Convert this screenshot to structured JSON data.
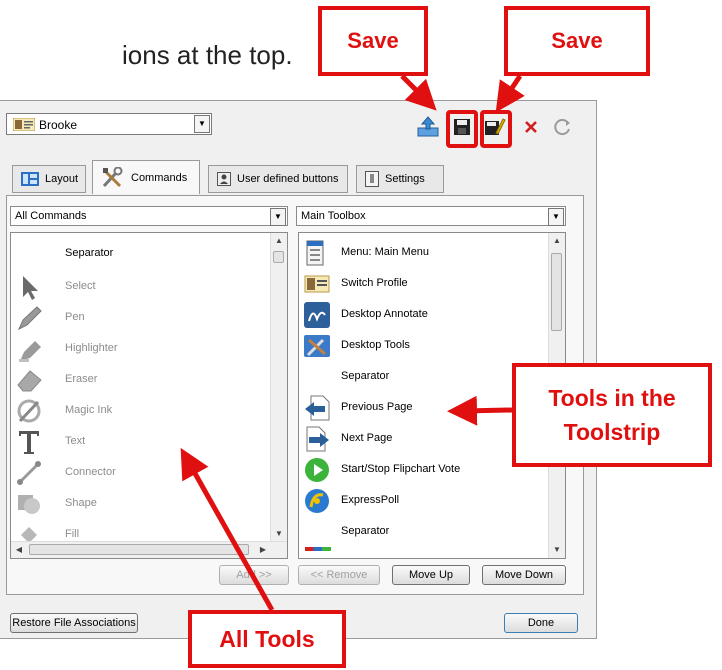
{
  "caption": "ions at the top.",
  "profile": {
    "name": "Brooke"
  },
  "tabs": [
    {
      "label": "Layout"
    },
    {
      "label": "Commands"
    },
    {
      "label": "User defined buttons"
    },
    {
      "label": "Settings"
    }
  ],
  "left_combo": "All Commands",
  "right_combo": "Main Toolbox",
  "left_list": [
    "Separator",
    "Select",
    "Pen",
    "Highlighter",
    "Eraser",
    "Magic Ink",
    "Text",
    "Connector",
    "Shape",
    "Fill"
  ],
  "right_list": [
    "Menu: Main Menu",
    "Switch Profile",
    "Desktop Annotate",
    "Desktop Tools",
    "Separator",
    "Previous Page",
    "Next Page",
    "Start/Stop Flipchart Vote",
    "ExpressPoll",
    "Separator"
  ],
  "buttons": {
    "add": "Add >>",
    "remove": "<< Remove",
    "move_up": "Move Up",
    "move_down": "Move Down",
    "restore": "Restore File Associations",
    "done": "Done"
  },
  "callouts": {
    "save1": "Save",
    "save2": "Save",
    "tools_line1": "Tools in the",
    "tools_line2": "Toolstrip",
    "all_tools": "All Tools"
  },
  "colors": {
    "callout": "#e01010",
    "accent": "#2a6fc4"
  }
}
